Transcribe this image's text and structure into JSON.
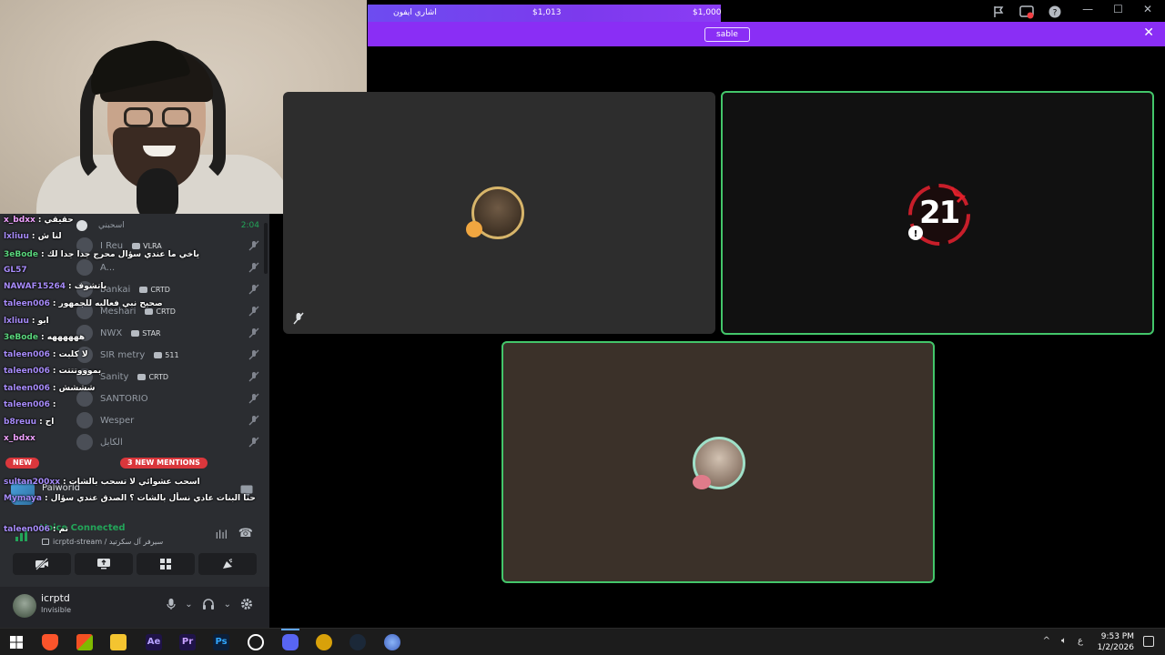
{
  "donation": {
    "label": "اشاري ايفون",
    "current": "$1,013",
    "goal": "$1,000"
  },
  "promo": {
    "button": "sable",
    "close": "✕"
  },
  "window": {
    "minimize": "—",
    "maximize": "☐",
    "close": "✕"
  },
  "voice_channel": {
    "header_name": "اسحبني",
    "elapsed": "2:04",
    "members": [
      {
        "name": "I Reu",
        "badge": "VLRA"
      },
      {
        "name": "A...",
        "badge": ""
      },
      {
        "name": "bankai",
        "badge": "CRTD"
      },
      {
        "name": "Meshari",
        "badge": "CRTD"
      },
      {
        "name": "NWX",
        "badge": "STAR"
      },
      {
        "name": "SIR metry",
        "badge": "511"
      },
      {
        "name": "Sanity",
        "badge": "CRTD"
      },
      {
        "name": "SANTORIO",
        "badge": ""
      },
      {
        "name": "Wesper",
        "badge": ""
      },
      {
        "name": "الكابل",
        "badge": ""
      }
    ]
  },
  "chat": [
    {
      "user": "x_bdxx",
      "msg": ": حقيقي"
    },
    {
      "user": "lxliuu",
      "msg": ": لنا ش"
    },
    {
      "user": "3eBode",
      "msg": ": ياخي ما عندي سؤال محرج جدا جدا لك"
    },
    {
      "user": "GL57",
      "msg": ""
    },
    {
      "user": "NAWAF15264",
      "msg": ": ياتشوف"
    },
    {
      "user": "taleen006",
      "msg": ": صحيح نبي فعاليه للجمهور"
    },
    {
      "user": "lxliuu",
      "msg": ": ابو"
    },
    {
      "user": "3eBode",
      "msg": ": ههههههه"
    },
    {
      "user": "taleen006",
      "msg": ": لا كلبت"
    },
    {
      "user": "taleen006",
      "msg": ": بموووتتتت"
    },
    {
      "user": "taleen006",
      "msg": ": شششش"
    },
    {
      "user": "taleen006",
      "msg": ":"
    },
    {
      "user": "b8reuu",
      "msg": ": اح"
    },
    {
      "user": "x_bdxx",
      "msg": ""
    },
    {
      "user": "sultan200xx",
      "msg": ": اسحب عشوائي لا تسحب بالشات"
    },
    {
      "user": "Mymaya",
      "msg": ": حنا البنات عادي نسأل بالشات ؟ الصدق عندي سؤال"
    },
    {
      "user": "taleen006",
      "msg": ": تم"
    }
  ],
  "pills": {
    "new": "NEW",
    "mentions": "3 NEW MENTIONS"
  },
  "activity": {
    "name": "Palworld"
  },
  "voice_status": {
    "status": "Voice Connected",
    "channel": "icrptd-stream / سيرفر آل سكرتيد"
  },
  "user": {
    "name": "icrptd",
    "status": "Invisible"
  },
  "stage": {
    "tile_b_text": "21"
  },
  "taskbar": {
    "icons": [
      "windows-icon",
      "brave-icon",
      "store-icon",
      "explorer-icon",
      "ae-icon",
      "pr-icon",
      "ps-icon",
      "obs-icon",
      "discord-icon",
      "app-icon",
      "steam-icon",
      "browser-icon"
    ],
    "ae": "Ae",
    "pr": "Pr",
    "ps": "Ps",
    "lang": "ع",
    "time": "9:53 PM",
    "date": "1/2/2026"
  },
  "colors": {
    "accent_green": "#43c66a",
    "promo": "#8a2ef5",
    "mention_red": "#da373c"
  }
}
